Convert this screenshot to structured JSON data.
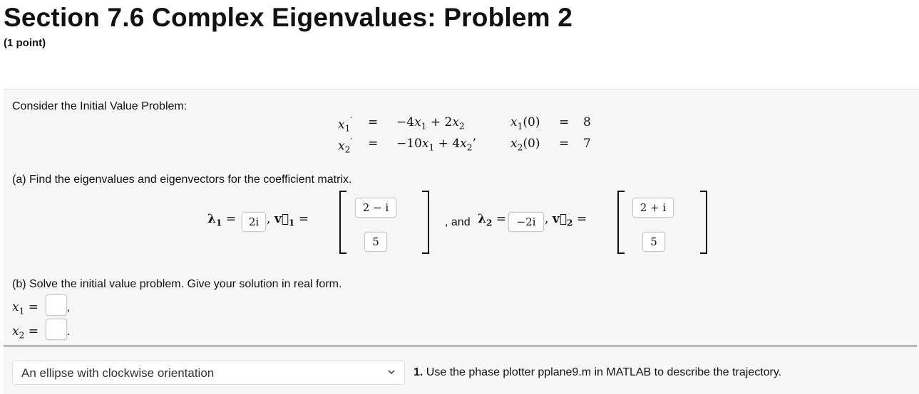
{
  "header": {
    "title": "Section 7.6 Complex Eigenvalues: Problem 2",
    "points": "(1 point)"
  },
  "problem": {
    "intro": "Consider the Initial Value Problem:",
    "system": {
      "lhs1": "x′",
      "lhs2": "x′",
      "rhs1": "−4x₁ + 2x₂",
      "rhs2": "−10x₁ + 4x₂",
      "ic1_lhs": "x₁(0)",
      "ic1_val": "8",
      "ic2_lhs": "x₂(0)",
      "ic2_val": "7",
      "eq": "="
    },
    "part_a": {
      "prompt": "(a) Find the eigenvalues and eigenvectors for the coefficient matrix.",
      "lambda1_answer": "2i",
      "v1_top": "2 − i",
      "v1_bottom": "5",
      "and_text": ", and",
      "lambda2_answer": "−2i",
      "v2_top": "2 + i",
      "v2_bottom": "5"
    },
    "part_b": {
      "prompt": "(b) Solve the initial value problem. Give your solution in real form.",
      "x1_answer": "",
      "x2_answer": ""
    },
    "trajectory": {
      "selected": "An ellipse with clockwise orientation",
      "number": "1.",
      "question": "Use the phase plotter pplane9.m in MATLAB to describe the trajectory."
    }
  }
}
